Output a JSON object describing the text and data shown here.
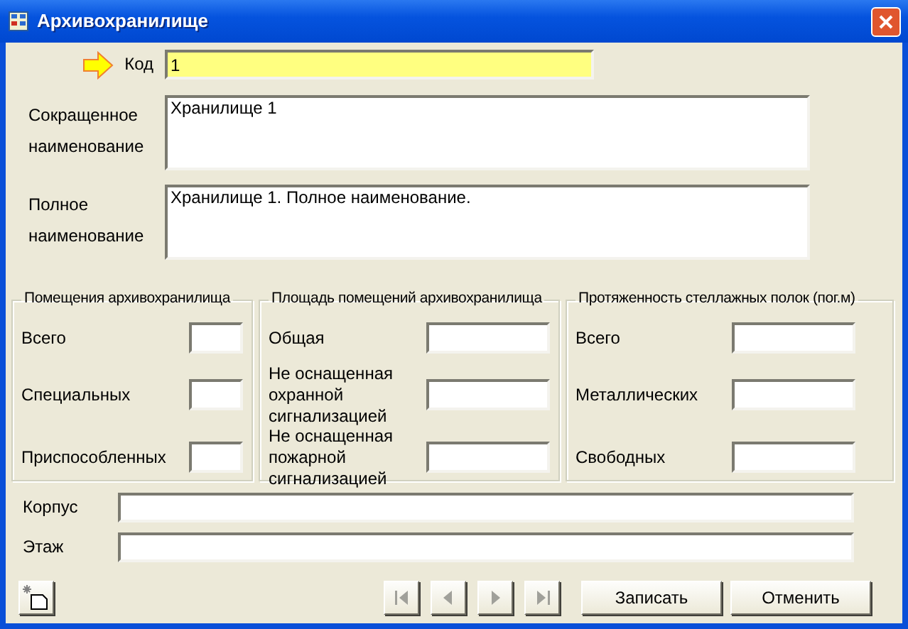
{
  "window": {
    "title": "Архивохранилище"
  },
  "fields": [
    {
      "kind": "line",
      "label": "Код",
      "value": "1",
      "current": true
    },
    {
      "kind": "area",
      "label": "Сокращенное наименование",
      "value": "Хранилище 1",
      "current": false
    },
    {
      "kind": "area",
      "label": "Полное наименование",
      "value": "Хранилище 1. Полное наименование.",
      "current": false
    }
  ],
  "groups": [
    {
      "title": "Помещения архивохранилища",
      "rows": [
        {
          "label": "Всего"
        },
        {
          "label": "Специальных"
        },
        {
          "label": "Приспособленных"
        }
      ]
    },
    {
      "title": "Площадь помещений архивохранилища",
      "rows": [
        {
          "label": "Общая"
        },
        {
          "label": "Не оснащенная охранной сигнализацией"
        },
        {
          "label": "Не оснащенная пожарной сигнализацией"
        }
      ]
    },
    {
      "title": "Протяженность стеллажных полок (пог.м)",
      "rows": [
        {
          "label": "Всего"
        },
        {
          "label": "Металлических"
        },
        {
          "label": "Свободных"
        }
      ]
    }
  ],
  "bottom_fields": [
    {
      "label": "Корпус"
    },
    {
      "label": "Этаж"
    }
  ],
  "navigation": [
    {
      "kind": "first",
      "disabled": true
    },
    {
      "kind": "previous",
      "disabled": true
    },
    {
      "kind": "next",
      "disabled": true
    },
    {
      "kind": "last",
      "disabled": true
    }
  ],
  "buttons": [
    "Записать",
    "Отменить"
  ]
}
